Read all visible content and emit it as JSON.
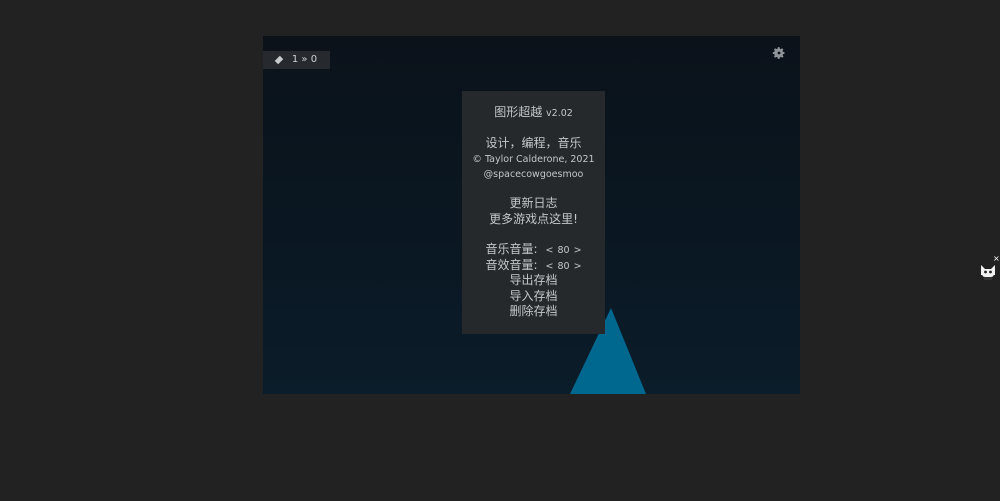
{
  "game": {
    "score": {
      "icon": "diamond-icon",
      "text": "1 » 0"
    },
    "settings_icon": "gear-icon",
    "menu": {
      "title": "图形超越",
      "version": "v2.02",
      "credits_line": "设计，编程，音乐",
      "copyright": "© Taylor Calderone, 2021",
      "handle": "@spacecowgoesmoo",
      "changelog": "更新日志",
      "more_games": "更多游戏点这里!",
      "music_volume_label": "音乐音量:",
      "music_volume_value": "80",
      "sfx_volume_label": "音效音量:",
      "sfx_volume_value": "80",
      "decrease_symbol": "<",
      "increase_symbol": ">",
      "export_save": "导出存档",
      "import_save": "导入存档",
      "delete_save": "删除存档"
    },
    "triangle_color": "#00678f"
  },
  "side_widget": {
    "icon": "cat-face-icon",
    "close_symbol": "×"
  }
}
